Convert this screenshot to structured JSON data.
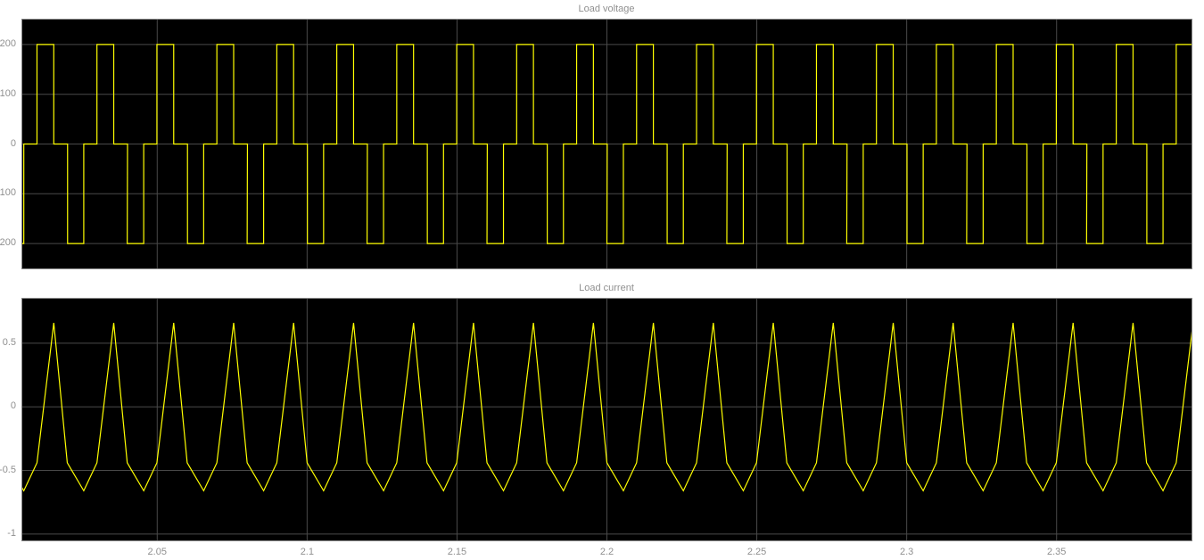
{
  "chart_data": [
    {
      "type": "line",
      "title": "Load voltage",
      "xlabel": "",
      "ylabel": "",
      "xlim": [
        2.005,
        2.395
      ],
      "ylim": [
        -250,
        250
      ],
      "grid": true,
      "x_ticks": [
        2.05,
        2.1,
        2.15,
        2.2,
        2.25,
        2.3,
        2.35
      ],
      "y_ticks": [
        200,
        100,
        0,
        -100,
        -200
      ],
      "y_tick_labels": [
        "200",
        "100",
        "0",
        "-100",
        "-200"
      ],
      "waveform": "quasi-square",
      "period": 0.02,
      "amplitude": 200,
      "series": [
        {
          "x": [
            2.0,
            2.0055,
            2.0055,
            2.0099,
            2.0099,
            2.0155,
            2.0155,
            2.0201,
            2.0201,
            2.0255,
            2.0255,
            2.0299,
            2.0299,
            2.0355,
            2.0355,
            2.0401
          ],
          "y": [
            -200,
            -200,
            0,
            0,
            200,
            200,
            0,
            0,
            -200,
            -200,
            0,
            0,
            200,
            200,
            0,
            0
          ],
          "note_repeat_every": 0.04,
          "color": "#ffff00"
        }
      ]
    },
    {
      "type": "line",
      "title": "Load current",
      "xlabel": "",
      "ylabel": "",
      "xlim": [
        2.005,
        2.395
      ],
      "ylim": [
        -1.05,
        0.85
      ],
      "grid": true,
      "x_ticks": [
        2.05,
        2.1,
        2.15,
        2.2,
        2.25,
        2.3,
        2.35
      ],
      "x_tick_labels": [
        "2.05",
        "2.1",
        "2.15",
        "2.2",
        "2.25",
        "2.3",
        "2.35"
      ],
      "y_ticks": [
        0.5,
        0,
        -0.5,
        -1
      ],
      "y_tick_labels": [
        "0.5",
        "0",
        "-0.5",
        "-1"
      ],
      "waveform": "triangular",
      "period": 0.02,
      "series": [
        {
          "x": [
            2.0,
            2.0055,
            2.0099,
            2.0155,
            2.0201
          ],
          "y": [
            -0.44,
            -0.66,
            -0.44,
            0.66,
            0.44
          ],
          "color": "#ffff00"
        }
      ]
    }
  ]
}
